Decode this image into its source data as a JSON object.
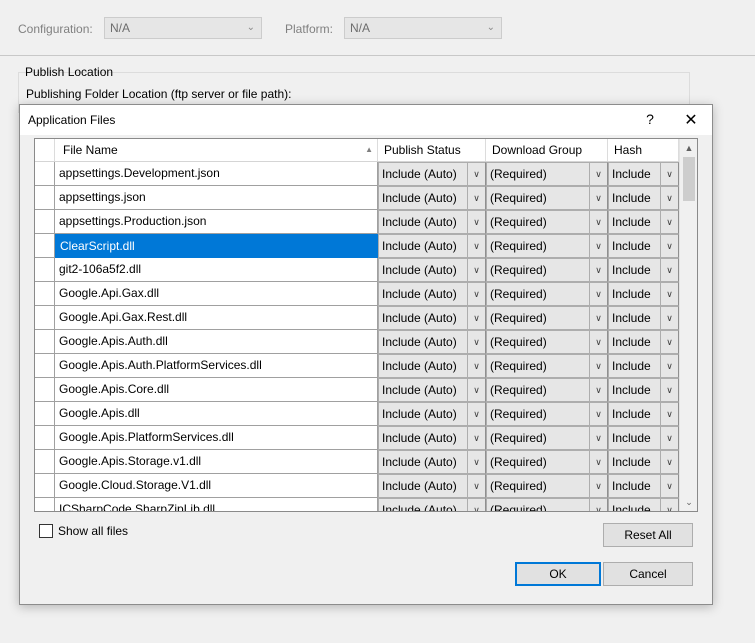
{
  "background": {
    "configuration_label": "Configuration:",
    "configuration_value": "N/A",
    "platform_label": "Platform:",
    "platform_value": "N/A",
    "publish_location_title": "Publish Location",
    "publishing_folder_label": "Publishing Folder Location (ftp server or file path):"
  },
  "dialog": {
    "title": "Application Files",
    "help_glyph": "?",
    "close_glyph": "✕",
    "columns": {
      "file_name": "File Name",
      "publish_status": "Publish Status",
      "download_group": "Download Group",
      "hash": "Hash"
    },
    "rows": [
      {
        "file": "appsettings.Development.json",
        "status": "Include (Auto)",
        "group": "(Required)",
        "hash": "Include"
      },
      {
        "file": "appsettings.json",
        "status": "Include (Auto)",
        "group": "(Required)",
        "hash": "Include"
      },
      {
        "file": "appsettings.Production.json",
        "status": "Include (Auto)",
        "group": "(Required)",
        "hash": "Include"
      },
      {
        "file": "ClearScript.dll",
        "status": "Include (Auto)",
        "group": "(Required)",
        "hash": "Include"
      },
      {
        "file": "git2-106a5f2.dll",
        "status": "Include (Auto)",
        "group": "(Required)",
        "hash": "Include"
      },
      {
        "file": "Google.Api.Gax.dll",
        "status": "Include (Auto)",
        "group": "(Required)",
        "hash": "Include"
      },
      {
        "file": "Google.Api.Gax.Rest.dll",
        "status": "Include (Auto)",
        "group": "(Required)",
        "hash": "Include"
      },
      {
        "file": "Google.Apis.Auth.dll",
        "status": "Include (Auto)",
        "group": "(Required)",
        "hash": "Include"
      },
      {
        "file": "Google.Apis.Auth.PlatformServices.dll",
        "status": "Include (Auto)",
        "group": "(Required)",
        "hash": "Include"
      },
      {
        "file": "Google.Apis.Core.dll",
        "status": "Include (Auto)",
        "group": "(Required)",
        "hash": "Include"
      },
      {
        "file": "Google.Apis.dll",
        "status": "Include (Auto)",
        "group": "(Required)",
        "hash": "Include"
      },
      {
        "file": "Google.Apis.PlatformServices.dll",
        "status": "Include (Auto)",
        "group": "(Required)",
        "hash": "Include"
      },
      {
        "file": "Google.Apis.Storage.v1.dll",
        "status": "Include (Auto)",
        "group": "(Required)",
        "hash": "Include"
      },
      {
        "file": "Google.Cloud.Storage.V1.dll",
        "status": "Include (Auto)",
        "group": "(Required)",
        "hash": "Include"
      },
      {
        "file": "ICSharpCode.SharpZipLib.dll",
        "status": "Include (Auto)",
        "group": "(Required)",
        "hash": "Include"
      }
    ],
    "selected_row_index": 3,
    "show_all_files_label": "Show all files",
    "show_all_files_checked": false,
    "reset_all_label": "Reset All",
    "ok_label": "OK",
    "cancel_label": "Cancel"
  },
  "colors": {
    "selection": "#0078d7",
    "dialog_bg": "#f0f0f0",
    "combo_bg": "#e6e6e6"
  },
  "icons": {
    "dropdown": "chevron-down-icon",
    "sort": "sort-ascending-icon",
    "scroll_up": "scroll-up-icon",
    "scroll_down": "scroll-down-icon"
  }
}
